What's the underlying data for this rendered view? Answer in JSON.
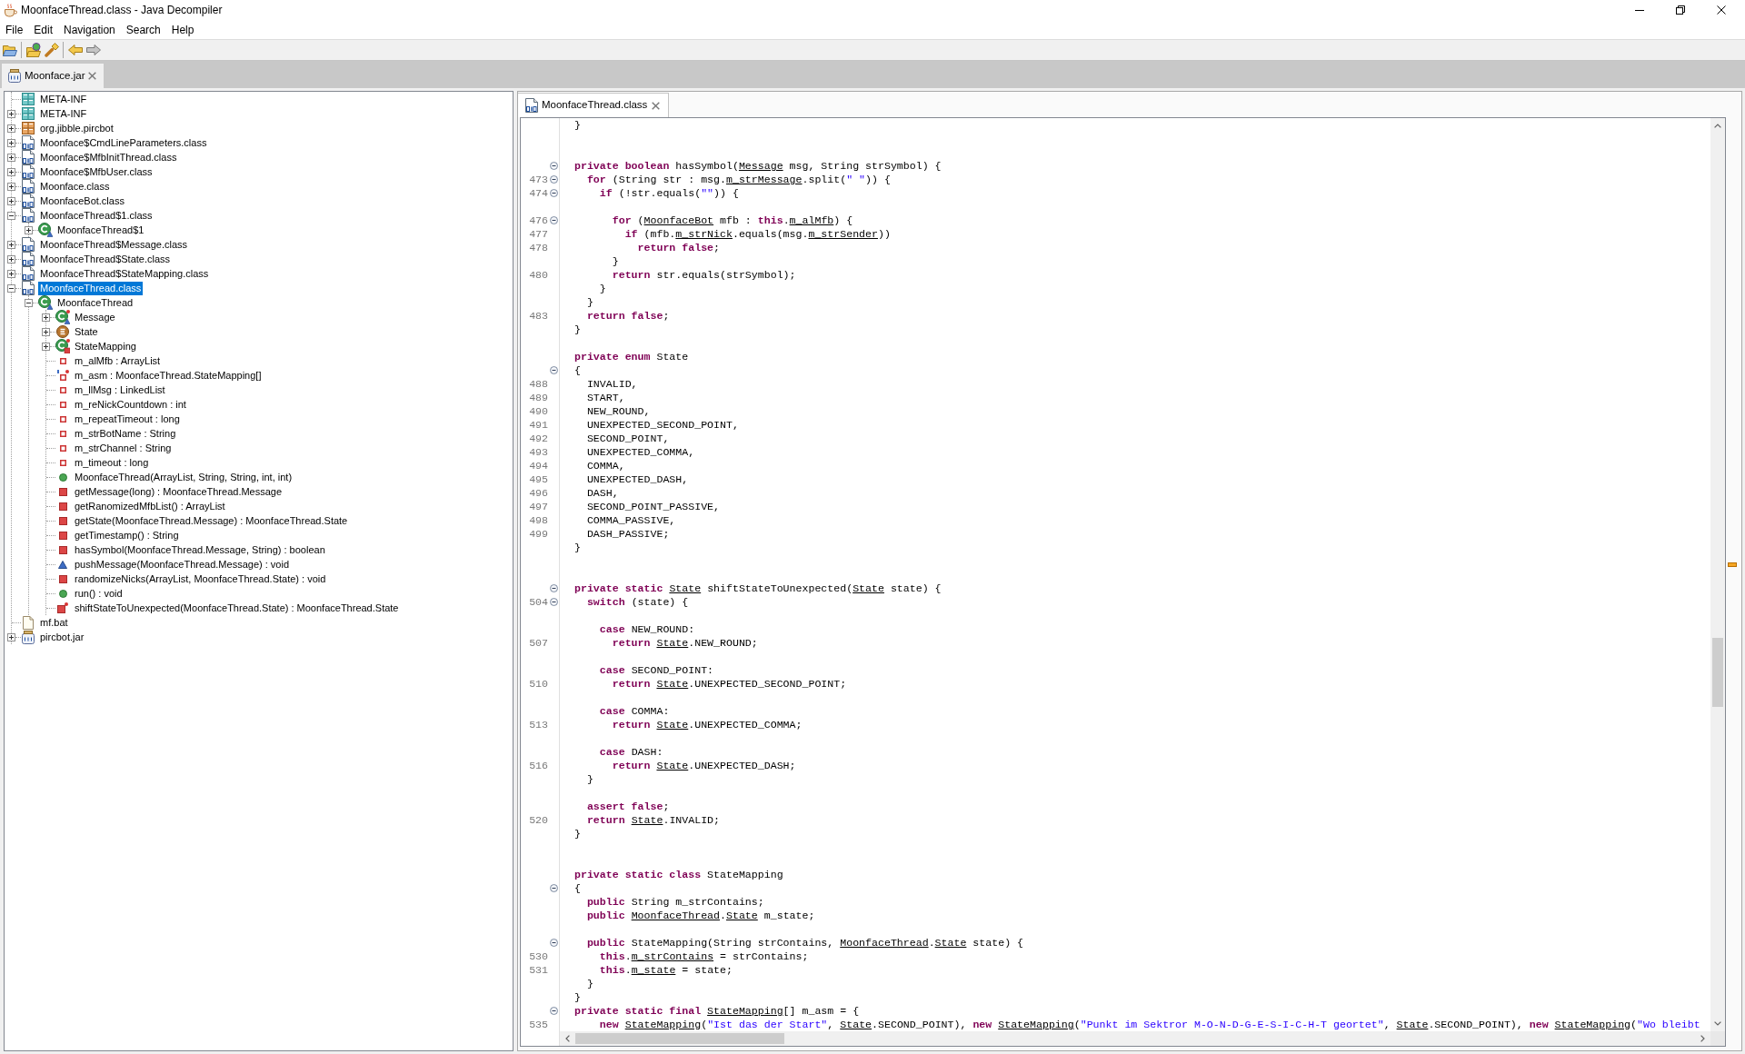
{
  "window": {
    "title": "MoonfaceThread.class - Java Decompiler"
  },
  "menu": [
    "File",
    "Edit",
    "Navigation",
    "Search",
    "Help"
  ],
  "toolbar": [
    [
      {
        "kind": "open_file",
        "disabled": false
      }
    ],
    [
      {
        "kind": "open_type",
        "disabled": false
      },
      {
        "kind": "search",
        "disabled": false
      }
    ],
    [
      {
        "kind": "back",
        "disabled": false
      },
      {
        "kind": "forward",
        "disabled": true
      }
    ]
  ],
  "archive_tabs": [
    {
      "label": "Moonface.jar",
      "selected": true
    }
  ],
  "tree": [
    {
      "label": "META-INF",
      "kind": "directory",
      "selected": false
    },
    {
      "label": "META-INF",
      "kind": "directory",
      "expanded": false,
      "selected": false
    },
    {
      "label": "org.jibble.pircbot",
      "kind": "package",
      "expanded": false,
      "selected": false
    },
    {
      "label": "Moonface$CmdLineParameters.class",
      "kind": "class_file",
      "expanded": false,
      "selected": false
    },
    {
      "label": "Moonface$MfbInitThread.class",
      "kind": "class_file",
      "expanded": false,
      "selected": false
    },
    {
      "label": "Moonface$MfbUser.class",
      "kind": "class_file",
      "expanded": false,
      "selected": false
    },
    {
      "label": "Moonface.class",
      "kind": "class_file",
      "expanded": false,
      "selected": false
    },
    {
      "label": "MoonfaceBot.class",
      "kind": "class_file",
      "expanded": false,
      "selected": false
    },
    {
      "label": "MoonfaceThread$1.class",
      "kind": "class_file",
      "expanded": true,
      "selected": false,
      "children": [
        {
          "label": "MoonfaceThread$1",
          "kind": "class",
          "expanded": false,
          "selected": false
        }
      ]
    },
    {
      "label": "MoonfaceThread$Message.class",
      "kind": "class_file",
      "expanded": false,
      "selected": false
    },
    {
      "label": "MoonfaceThread$State.class",
      "kind": "class_file",
      "expanded": false,
      "selected": false
    },
    {
      "label": "MoonfaceThread$StateMapping.class",
      "kind": "class_file",
      "expanded": false,
      "selected": false
    },
    {
      "label": "MoonfaceThread.class",
      "kind": "class_file",
      "expanded": true,
      "selected": true,
      "children": [
        {
          "label": "MoonfaceThread",
          "kind": "class",
          "expanded": true,
          "selected": false,
          "children": [
            {
              "label": "Message",
              "kind": "static_class",
              "expanded": false,
              "selected": false
            },
            {
              "label": "State",
              "kind": "enum",
              "expanded": false,
              "selected": false
            },
            {
              "label": "StateMapping",
              "kind": "static_private_class",
              "expanded": false,
              "selected": false
            },
            {
              "label": "m_alMfb : ArrayList",
              "kind": "field",
              "selected": false
            },
            {
              "label": "m_asm : MoonfaceThread.StateMapping[]",
              "kind": "static_final_field",
              "selected": false
            },
            {
              "label": "m_llMsg : LinkedList",
              "kind": "field",
              "selected": false
            },
            {
              "label": "m_reNickCountdown : int",
              "kind": "field",
              "selected": false
            },
            {
              "label": "m_repeatTimeout : long",
              "kind": "field",
              "selected": false
            },
            {
              "label": "m_strBotName : String",
              "kind": "field",
              "selected": false
            },
            {
              "label": "m_strChannel : String",
              "kind": "field",
              "selected": false
            },
            {
              "label": "m_timeout : long",
              "kind": "field",
              "selected": false
            },
            {
              "label": "MoonfaceThread(ArrayList, String, String, int, int)",
              "kind": "public_method",
              "selected": false
            },
            {
              "label": "getMessage(long) : MoonfaceThread.Message",
              "kind": "private_method",
              "selected": false
            },
            {
              "label": "getRanomizedMfbList() : ArrayList",
              "kind": "private_method",
              "selected": false
            },
            {
              "label": "getState(MoonfaceThread.Message) : MoonfaceThread.State",
              "kind": "private_method",
              "selected": false
            },
            {
              "label": "getTimestamp() : String",
              "kind": "private_method",
              "selected": false
            },
            {
              "label": "hasSymbol(MoonfaceThread.Message, String) : boolean",
              "kind": "private_method",
              "selected": false
            },
            {
              "label": "pushMessage(MoonfaceThread.Message) : void",
              "kind": "package_method",
              "selected": false
            },
            {
              "label": "randomizeNicks(ArrayList, MoonfaceThread.State) : void",
              "kind": "private_method",
              "selected": false
            },
            {
              "label": "run() : void",
              "kind": "public_method",
              "selected": false
            },
            {
              "label": "shiftStateToUnexpected(MoonfaceThread.State) : MoonfaceThread.State",
              "kind": "private_static_method",
              "selected": false
            }
          ]
        }
      ]
    },
    {
      "label": "mf.bat",
      "kind": "file",
      "selected": false
    },
    {
      "label": "pircbot.jar",
      "kind": "jar",
      "expanded": false,
      "selected": false
    }
  ],
  "editor_tabs": [
    {
      "label": "MoonfaceThread.class",
      "selected": true
    }
  ],
  "code": [
    {
      "fold_marker": false,
      "segments": [
        {
          "kind": "plain",
          "text": "}"
        }
      ]
    },
    {
      "fold_marker": false
    },
    {
      "fold_marker": false
    },
    {
      "fold_marker": true,
      "segments": [
        {
          "kind": "keyword",
          "text": "private boolean"
        },
        {
          "kind": "plain",
          "text": " hasSymbol("
        },
        {
          "kind": "reference",
          "text": "Message"
        },
        {
          "kind": "plain",
          "text": " msg, String strSymbol) {"
        }
      ]
    },
    {
      "number": "473",
      "fold_marker": true,
      "segments": [
        {
          "kind": "keyword",
          "text": "  for"
        },
        {
          "kind": "plain",
          "text": " (String str : msg."
        },
        {
          "kind": "reference",
          "text": "m_strMessage"
        },
        {
          "kind": "plain",
          "text": ".split("
        },
        {
          "kind": "string",
          "text": "\" \""
        },
        {
          "kind": "plain",
          "text": ")) {"
        }
      ]
    },
    {
      "number": "474",
      "fold_marker": true,
      "segments": [
        {
          "kind": "keyword",
          "text": "    if"
        },
        {
          "kind": "plain",
          "text": " (!str.equals("
        },
        {
          "kind": "string",
          "text": "\"\""
        },
        {
          "kind": "plain",
          "text": ")) {"
        }
      ]
    },
    {
      "fold_marker": false
    },
    {
      "number": "476",
      "fold_marker": true,
      "segments": [
        {
          "kind": "keyword",
          "text": "      for"
        },
        {
          "kind": "plain",
          "text": " ("
        },
        {
          "kind": "reference",
          "text": "MoonfaceBot"
        },
        {
          "kind": "plain",
          "text": " mfb : "
        },
        {
          "kind": "keyword",
          "text": "this"
        },
        {
          "kind": "plain",
          "text": "."
        },
        {
          "kind": "reference",
          "text": "m_alMfb"
        },
        {
          "kind": "plain",
          "text": ") {"
        }
      ]
    },
    {
      "number": "477",
      "fold_marker": false,
      "segments": [
        {
          "kind": "keyword",
          "text": "        if"
        },
        {
          "kind": "plain",
          "text": " (mfb."
        },
        {
          "kind": "reference",
          "text": "m_strNick"
        },
        {
          "kind": "plain",
          "text": ".equals(msg."
        },
        {
          "kind": "reference",
          "text": "m_strSender"
        },
        {
          "kind": "plain",
          "text": "))"
        }
      ]
    },
    {
      "number": "478",
      "fold_marker": false,
      "segments": [
        {
          "kind": "keyword",
          "text": "          return false"
        },
        {
          "kind": "plain",
          "text": ";"
        }
      ]
    },
    {
      "fold_marker": false,
      "segments": [
        {
          "kind": "plain",
          "text": "      }"
        }
      ]
    },
    {
      "number": "480",
      "fold_marker": false,
      "segments": [
        {
          "kind": "keyword",
          "text": "      return"
        },
        {
          "kind": "plain",
          "text": " str.equals(strSymbol);"
        }
      ]
    },
    {
      "fold_marker": false,
      "segments": [
        {
          "kind": "plain",
          "text": "    }"
        }
      ]
    },
    {
      "fold_marker": false,
      "segments": [
        {
          "kind": "plain",
          "text": "  }"
        }
      ]
    },
    {
      "number": "483",
      "fold_marker": false,
      "segments": [
        {
          "kind": "keyword",
          "text": "  return false"
        },
        {
          "kind": "plain",
          "text": ";"
        }
      ]
    },
    {
      "fold_marker": false,
      "segments": [
        {
          "kind": "plain",
          "text": "}"
        }
      ]
    },
    {
      "fold_marker": false
    },
    {
      "fold_marker": false,
      "segments": [
        {
          "kind": "keyword",
          "text": "private enum"
        },
        {
          "kind": "plain",
          "text": " State"
        }
      ]
    },
    {
      "fold_marker": true,
      "segments": [
        {
          "kind": "plain",
          "text": "{"
        }
      ]
    },
    {
      "number": "488",
      "fold_marker": false,
      "segments": [
        {
          "kind": "plain",
          "text": "  INVALID,"
        }
      ]
    },
    {
      "number": "489",
      "fold_marker": false,
      "segments": [
        {
          "kind": "plain",
          "text": "  START,"
        }
      ]
    },
    {
      "number": "490",
      "fold_marker": false,
      "segments": [
        {
          "kind": "plain",
          "text": "  NEW_ROUND,"
        }
      ]
    },
    {
      "number": "491",
      "fold_marker": false,
      "segments": [
        {
          "kind": "plain",
          "text": "  UNEXPECTED_SECOND_POINT,"
        }
      ]
    },
    {
      "number": "492",
      "fold_marker": false,
      "segments": [
        {
          "kind": "plain",
          "text": "  SECOND_POINT,"
        }
      ]
    },
    {
      "number": "493",
      "fold_marker": false,
      "segments": [
        {
          "kind": "plain",
          "text": "  UNEXPECTED_COMMA,"
        }
      ]
    },
    {
      "number": "494",
      "fold_marker": false,
      "segments": [
        {
          "kind": "plain",
          "text": "  COMMA,"
        }
      ]
    },
    {
      "number": "495",
      "fold_marker": false,
      "segments": [
        {
          "kind": "plain",
          "text": "  UNEXPECTED_DASH,"
        }
      ]
    },
    {
      "number": "496",
      "fold_marker": false,
      "segments": [
        {
          "kind": "plain",
          "text": "  DASH,"
        }
      ]
    },
    {
      "number": "497",
      "fold_marker": false,
      "segments": [
        {
          "kind": "plain",
          "text": "  SECOND_POINT_PASSIVE,"
        }
      ]
    },
    {
      "number": "498",
      "fold_marker": false,
      "segments": [
        {
          "kind": "plain",
          "text": "  COMMA_PASSIVE,"
        }
      ]
    },
    {
      "number": "499",
      "fold_marker": false,
      "segments": [
        {
          "kind": "plain",
          "text": "  DASH_PASSIVE;"
        }
      ]
    },
    {
      "fold_marker": false,
      "segments": [
        {
          "kind": "plain",
          "text": "}"
        }
      ]
    },
    {
      "fold_marker": false
    },
    {
      "fold_marker": false
    },
    {
      "fold_marker": true,
      "segments": [
        {
          "kind": "keyword",
          "text": "private static "
        },
        {
          "kind": "reference",
          "text": "State"
        },
        {
          "kind": "plain",
          "text": " shiftStateToUnexpected("
        },
        {
          "kind": "reference",
          "text": "State"
        },
        {
          "kind": "plain",
          "text": " state) {"
        }
      ]
    },
    {
      "number": "504",
      "fold_marker": true,
      "segments": [
        {
          "kind": "keyword",
          "text": "  switch"
        },
        {
          "kind": "plain",
          "text": " (state) {"
        }
      ]
    },
    {
      "fold_marker": false
    },
    {
      "fold_marker": false,
      "segments": [
        {
          "kind": "keyword",
          "text": "    case"
        },
        {
          "kind": "plain",
          "text": " NEW_ROUND:"
        }
      ]
    },
    {
      "number": "507",
      "fold_marker": false,
      "segments": [
        {
          "kind": "keyword",
          "text": "      return "
        },
        {
          "kind": "reference",
          "text": "State"
        },
        {
          "kind": "plain",
          "text": ".NEW_ROUND;"
        }
      ]
    },
    {
      "fold_marker": false
    },
    {
      "fold_marker": false,
      "segments": [
        {
          "kind": "keyword",
          "text": "    case"
        },
        {
          "kind": "plain",
          "text": " SECOND_POINT:"
        }
      ]
    },
    {
      "number": "510",
      "fold_marker": false,
      "segments": [
        {
          "kind": "keyword",
          "text": "      return "
        },
        {
          "kind": "reference",
          "text": "State"
        },
        {
          "kind": "plain",
          "text": ".UNEXPECTED_SECOND_POINT;"
        }
      ]
    },
    {
      "fold_marker": false
    },
    {
      "fold_marker": false,
      "segments": [
        {
          "kind": "keyword",
          "text": "    case"
        },
        {
          "kind": "plain",
          "text": " COMMA:"
        }
      ]
    },
    {
      "number": "513",
      "fold_marker": false,
      "segments": [
        {
          "kind": "keyword",
          "text": "      return "
        },
        {
          "kind": "reference",
          "text": "State"
        },
        {
          "kind": "plain",
          "text": ".UNEXPECTED_COMMA;"
        }
      ]
    },
    {
      "fold_marker": false
    },
    {
      "fold_marker": false,
      "segments": [
        {
          "kind": "keyword",
          "text": "    case"
        },
        {
          "kind": "plain",
          "text": " DASH:"
        }
      ]
    },
    {
      "number": "516",
      "fold_marker": false,
      "segments": [
        {
          "kind": "keyword",
          "text": "      return "
        },
        {
          "kind": "reference",
          "text": "State"
        },
        {
          "kind": "plain",
          "text": ".UNEXPECTED_DASH;"
        }
      ]
    },
    {
      "fold_marker": false,
      "segments": [
        {
          "kind": "plain",
          "text": "  }"
        }
      ]
    },
    {
      "fold_marker": false
    },
    {
      "fold_marker": false,
      "segments": [
        {
          "kind": "keyword",
          "text": "  assert false"
        },
        {
          "kind": "plain",
          "text": ";"
        }
      ]
    },
    {
      "number": "520",
      "fold_marker": false,
      "segments": [
        {
          "kind": "keyword",
          "text": "  return "
        },
        {
          "kind": "reference",
          "text": "State"
        },
        {
          "kind": "plain",
          "text": ".INVALID;"
        }
      ]
    },
    {
      "fold_marker": false,
      "segments": [
        {
          "kind": "plain",
          "text": "}"
        }
      ]
    },
    {
      "fold_marker": false
    },
    {
      "fold_marker": false
    },
    {
      "fold_marker": false,
      "segments": [
        {
          "kind": "keyword",
          "text": "private static class"
        },
        {
          "kind": "plain",
          "text": " StateMapping"
        }
      ]
    },
    {
      "fold_marker": true,
      "segments": [
        {
          "kind": "plain",
          "text": "{"
        }
      ]
    },
    {
      "fold_marker": false,
      "segments": [
        {
          "kind": "keyword",
          "text": "  public"
        },
        {
          "kind": "plain",
          "text": " String m_strContains;"
        }
      ]
    },
    {
      "fold_marker": false,
      "segments": [
        {
          "kind": "keyword",
          "text": "  public "
        },
        {
          "kind": "reference",
          "text": "MoonfaceThread"
        },
        {
          "kind": "plain",
          "text": "."
        },
        {
          "kind": "reference",
          "text": "State"
        },
        {
          "kind": "plain",
          "text": " m_state;"
        }
      ]
    },
    {
      "fold_marker": false
    },
    {
      "fold_marker": true,
      "segments": [
        {
          "kind": "keyword",
          "text": "  public"
        },
        {
          "kind": "plain",
          "text": " StateMapping(String strContains, "
        },
        {
          "kind": "reference",
          "text": "MoonfaceThread"
        },
        {
          "kind": "plain",
          "text": "."
        },
        {
          "kind": "reference",
          "text": "State"
        },
        {
          "kind": "plain",
          "text": " state) {"
        }
      ]
    },
    {
      "number": "530",
      "fold_marker": false,
      "segments": [
        {
          "kind": "keyword",
          "text": "    this"
        },
        {
          "kind": "plain",
          "text": "."
        },
        {
          "kind": "reference",
          "text": "m_strContains"
        },
        {
          "kind": "plain",
          "text": " = strContains;"
        }
      ]
    },
    {
      "number": "531",
      "fold_marker": false,
      "segments": [
        {
          "kind": "keyword",
          "text": "    this"
        },
        {
          "kind": "plain",
          "text": "."
        },
        {
          "kind": "reference",
          "text": "m_state"
        },
        {
          "kind": "plain",
          "text": " = state;"
        }
      ]
    },
    {
      "fold_marker": false,
      "segments": [
        {
          "kind": "plain",
          "text": "  }"
        }
      ]
    },
    {
      "fold_marker": false,
      "segments": [
        {
          "kind": "plain",
          "text": "}"
        }
      ]
    },
    {
      "fold_marker": true,
      "segments": [
        {
          "kind": "keyword",
          "text": "private static final "
        },
        {
          "kind": "reference",
          "text": "StateMapping"
        },
        {
          "kind": "plain",
          "text": "[] m_asm = {"
        }
      ]
    },
    {
      "number": "535",
      "fold_marker": false,
      "segments": [
        {
          "kind": "keyword",
          "text": "    new "
        },
        {
          "kind": "reference",
          "text": "StateMapping"
        },
        {
          "kind": "plain",
          "text": "("
        },
        {
          "kind": "string",
          "text": "\"Ist das der Start\""
        },
        {
          "kind": "plain",
          "text": ", "
        },
        {
          "kind": "reference",
          "text": "State"
        },
        {
          "kind": "plain",
          "text": ".SECOND_POINT), "
        },
        {
          "kind": "keyword",
          "text": "new "
        },
        {
          "kind": "reference",
          "text": "StateMapping"
        },
        {
          "kind": "plain",
          "text": "("
        },
        {
          "kind": "string",
          "text": "\"Punkt im Sektror M-O-N-D-G-E-S-I-C-H-T geortet\""
        },
        {
          "kind": "plain",
          "text": ", "
        },
        {
          "kind": "reference",
          "text": "State"
        },
        {
          "kind": "plain",
          "text": ".SECOND_POINT), "
        },
        {
          "kind": "keyword",
          "text": "new "
        },
        {
          "kind": "reference",
          "text": "StateMapping"
        },
        {
          "kind": "plain",
          "text": "("
        },
        {
          "kind": "string",
          "text": "\"Wo bleibt"
        }
      ]
    }
  ]
}
